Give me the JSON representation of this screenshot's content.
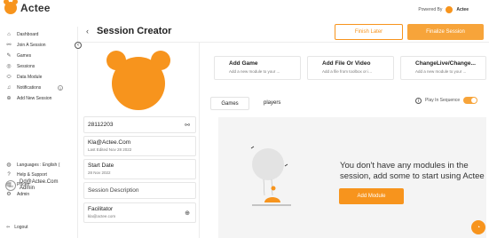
{
  "brand": {
    "name": "Actee",
    "powered_by_label": "Powered By",
    "powered_by_name": "Actee",
    "accent": "#f7941d"
  },
  "sidebar": {
    "items": [
      {
        "label": "Dashboard",
        "icon": "home-icon"
      },
      {
        "label": "Join A Session",
        "icon": "link-icon"
      },
      {
        "label": "Games",
        "icon": "pencil-icon"
      },
      {
        "label": "Sessions",
        "icon": "session-icon"
      },
      {
        "label": "Data Module",
        "icon": "data-icon"
      },
      {
        "label": "Notifications",
        "icon": "bell-icon",
        "badge": "1"
      },
      {
        "label": "Add New Session",
        "icon": "plus-icon"
      }
    ],
    "bottom_items": [
      {
        "label": "Languages : English (",
        "icon": "globe-icon"
      },
      {
        "label": "Help & Support",
        "icon": "help-icon"
      },
      {
        "label": "Prices",
        "icon": "price-icon"
      },
      {
        "label": "Admin",
        "icon": "gear-icon"
      }
    ],
    "profile": {
      "initials": "Dd",
      "email": "Dd@Actee.Com",
      "role": "Admin"
    },
    "logout_label": "Logout"
  },
  "header": {
    "title": "Session Creator",
    "finish_later_label": "Finish Later",
    "finalize_label": "Finalize Session"
  },
  "details": {
    "session_code": "28112203",
    "owner_email": "Kla@Actee.Com",
    "last_edited": "Last Edited Nov 28 2022",
    "start_date_label": "Start Date",
    "start_date_value": "28 Nov 2022",
    "description_placeholder": "Session Description",
    "facilitator_label": "Facilitator",
    "facilitator_value": "kla@actee.com"
  },
  "add_cards": [
    {
      "title": "Add Game",
      "desc": "Add a new module to your ..."
    },
    {
      "title": "Add File Or Video",
      "desc": "Add a file from toolbox or i..."
    },
    {
      "title": "ChangeLive/Change...",
      "desc": "Add a new module to your ..."
    }
  ],
  "tabs": {
    "games": "Games",
    "players": "players"
  },
  "play_in_sequence_label": "Play In Sequence",
  "empty_state": {
    "line1": "You don't have any modules in the",
    "line2": "session, add some to start using Actee",
    "button": "Add Module"
  }
}
